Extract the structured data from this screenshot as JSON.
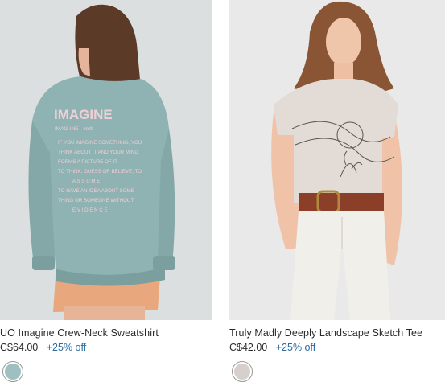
{
  "products": [
    {
      "name": "UO Imagine Crew-Neck Sweatshirt",
      "price": "C$64.00",
      "discount": "+25% off",
      "swatch_color": "#9fc0c0",
      "image": {
        "title": "IMAGINE",
        "subtitle": "IMAG·INE · verb",
        "text_lines": [
          "IF YOU IMAGINE SOMETHING, YOU",
          "THINK ABOUT IT AND YOUR MIND",
          "FORMS A PICTURE OF IT",
          "TO THINK, GUESS OR BELIEVE, TO",
          "A S S U M E",
          "TO HAVE AN IDEA ABOUT SOME-",
          "THING OR SOMEONE WITHOUT",
          "E V I D E N C E"
        ]
      }
    },
    {
      "name": "Truly Madly Deeply Landscape Sketch Tee",
      "price": "C$42.00",
      "discount": "+25% off",
      "swatch_color": "#d7cfcb"
    }
  ],
  "colors": {
    "discount": "#2c6aa0",
    "sweatshirt": "#8fb2b3",
    "tee": "#e3dcd6"
  }
}
